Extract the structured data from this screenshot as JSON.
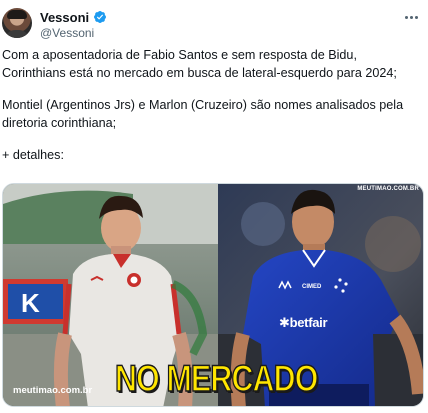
{
  "author": {
    "display_name": "Vessoni",
    "handle": "@Vessoni",
    "verified": true
  },
  "tweet": {
    "paragraph_1": "Com a aposentadoria de Fabio Santos e sem resposta de Bidu, Corinthians está no mercado em busca de lateral-esquerdo para 2024;",
    "paragraph_2": "Montiel (Argentinos Jrs) e Marlon (Cruzeiro) são nomes analisados pela diretoria corinthiana;",
    "paragraph_3": "+ detalhes:"
  },
  "media": {
    "headline": "NO MERCADO",
    "watermark_top": "MEUTIMAO.COM.BR",
    "watermark_bottom": "meutimao.com.br",
    "sponsor_text": "betfair",
    "sponsor_brand": "CIMED"
  },
  "colors": {
    "verified_badge": "#1d9bf0",
    "headline_fill": "#ffe600",
    "cruzeiro_blue": "#1a3aa8"
  },
  "icons": {
    "more": "more-horizontal-icon",
    "verified": "verified-badge-icon"
  }
}
